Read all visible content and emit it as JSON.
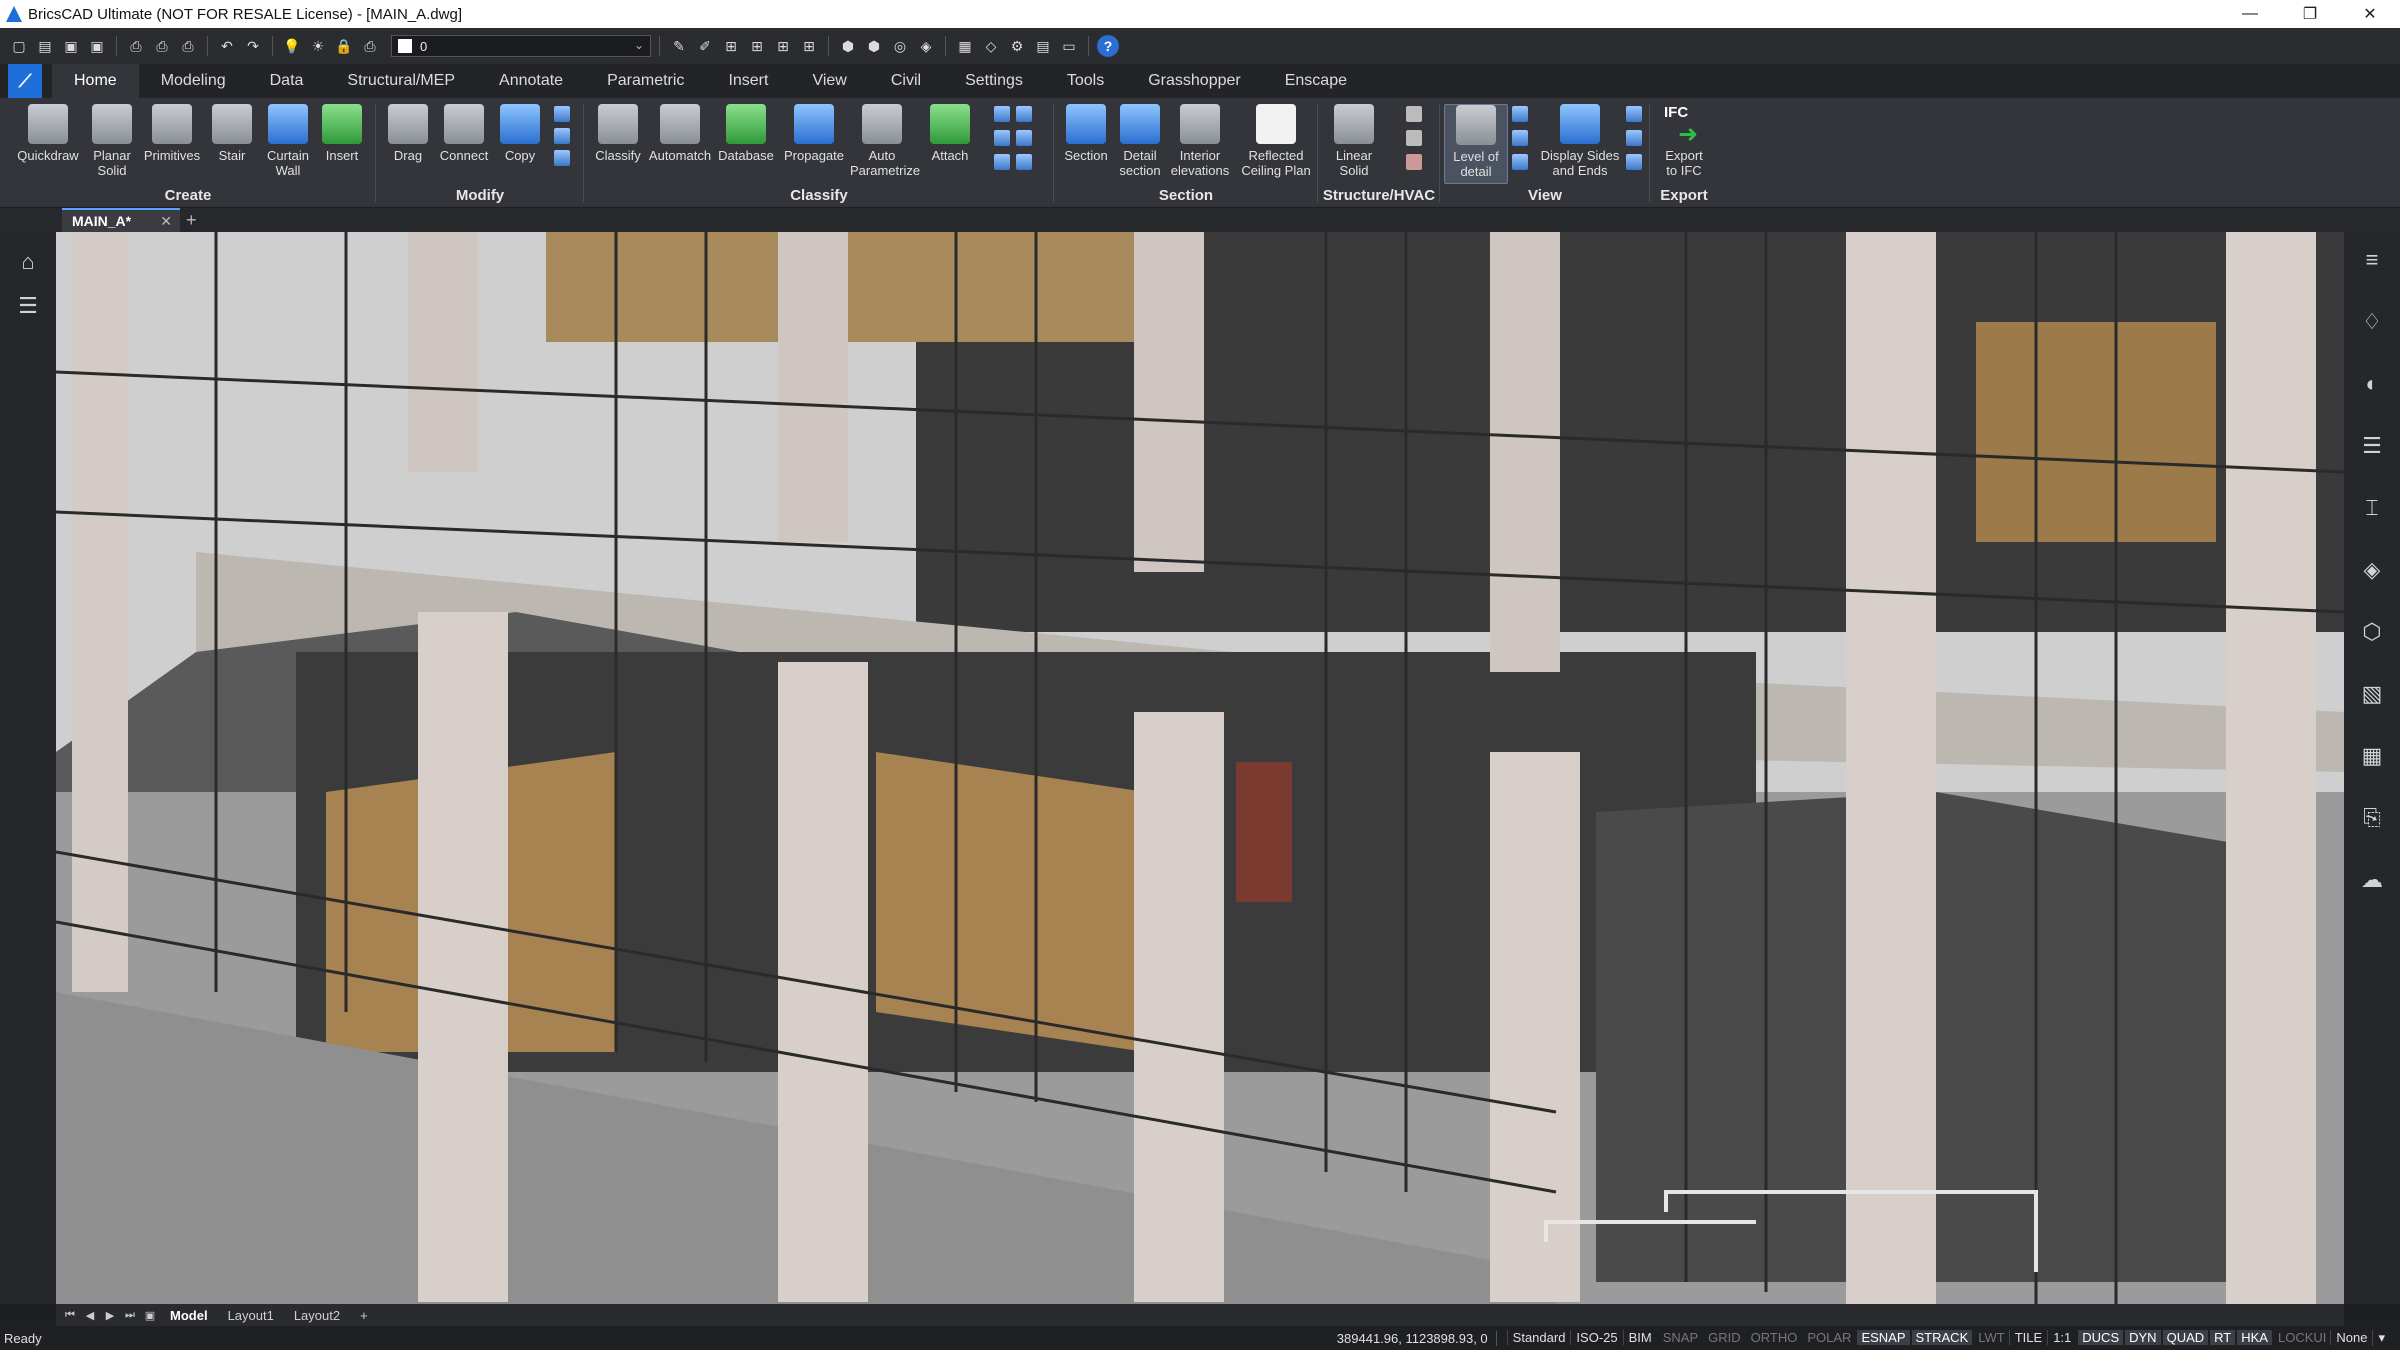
{
  "window": {
    "title": "BricsCAD Ultimate (NOT FOR RESALE License) - [MAIN_A.dwg]",
    "minimize": "—",
    "maximize": "❐",
    "close": "✕"
  },
  "qat": {
    "layer_value": "0",
    "help": "?"
  },
  "ribbon_tabs": [
    "Home",
    "Modeling",
    "Data",
    "Structural/MEP",
    "Annotate",
    "Parametric",
    "Insert",
    "View",
    "Civil",
    "Settings",
    "Tools",
    "Grasshopper",
    "Enscape"
  ],
  "active_tab": "Home",
  "groups": {
    "create": {
      "label": "Create",
      "buttons": [
        "Quickdraw",
        "Planar\nSolid",
        "Primitives",
        "Stair",
        "Curtain\nWall",
        "Insert"
      ]
    },
    "modify": {
      "label": "Modify",
      "buttons": [
        "Drag",
        "Connect",
        "Copy"
      ]
    },
    "classify": {
      "label": "Classify",
      "buttons": [
        "Classify",
        "Automatch",
        "Database",
        "Propagate",
        "Auto\nParametrize",
        "Attach"
      ]
    },
    "section": {
      "label": "Section",
      "buttons": [
        "Section",
        "Detail\nsection",
        "Interior\nelevations",
        "Reflected\nCeiling Plan"
      ]
    },
    "structure": {
      "label": "Structure/HVAC",
      "buttons": [
        "Linear\nSolid"
      ]
    },
    "view": {
      "label": "View",
      "buttons": [
        "Level of\ndetail",
        "Display Sides\nand Ends"
      ]
    },
    "export": {
      "label": "Export",
      "buttons": [
        "Export\nto IFC"
      ],
      "ifc_text": "IFC"
    }
  },
  "document": {
    "tab_name": "MAIN_A*",
    "close": "✕",
    "add": "+"
  },
  "layout_tabs": [
    "Model",
    "Layout1",
    "Layout2"
  ],
  "layout_add": "+",
  "status": {
    "ready": "Ready",
    "coords": "389441.96, 1123898.93, 0",
    "items": [
      {
        "text": "Standard",
        "state": "text"
      },
      {
        "text": "ISO-25",
        "state": "text"
      },
      {
        "text": "BIM",
        "state": "text"
      },
      {
        "text": "SNAP",
        "state": "off"
      },
      {
        "text": "GRID",
        "state": "off"
      },
      {
        "text": "ORTHO",
        "state": "off"
      },
      {
        "text": "POLAR",
        "state": "off"
      },
      {
        "text": "ESNAP",
        "state": "on"
      },
      {
        "text": "STRACK",
        "state": "on"
      },
      {
        "text": "LWT",
        "state": "off"
      },
      {
        "text": "TILE",
        "state": "text"
      },
      {
        "text": "1:1",
        "state": "text"
      },
      {
        "text": "DUCS",
        "state": "on"
      },
      {
        "text": "DYN",
        "state": "on"
      },
      {
        "text": "QUAD",
        "state": "on"
      },
      {
        "text": "RT",
        "state": "on"
      },
      {
        "text": "HKA",
        "state": "on"
      },
      {
        "text": "LOCKUI",
        "state": "off"
      },
      {
        "text": "None",
        "state": "text"
      }
    ]
  },
  "colors": {
    "accent": "#1e6fd9",
    "ribbon_bg": "#33353a",
    "viewport_floor": "#9a9a9a"
  }
}
